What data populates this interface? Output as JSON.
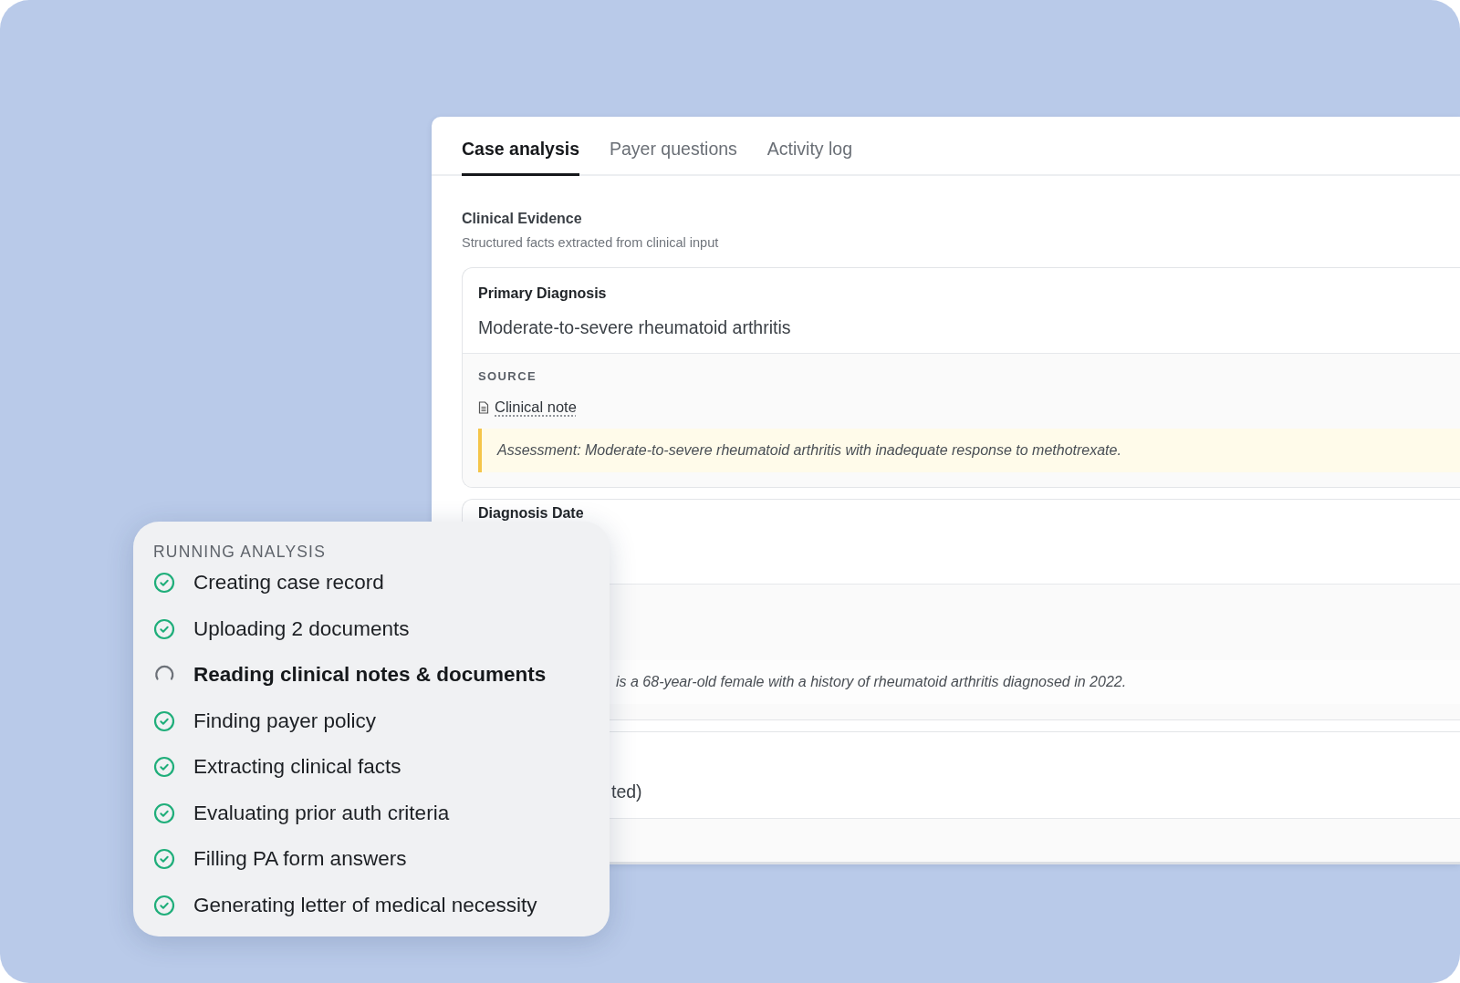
{
  "tabs": [
    {
      "label": "Case analysis",
      "selected": true
    },
    {
      "label": "Payer questions",
      "selected": false
    },
    {
      "label": "Activity log",
      "selected": false
    }
  ],
  "section": {
    "title": "Clinical Evidence",
    "subtitle": "Structured facts extracted from clinical input"
  },
  "evidence": [
    {
      "label": "Primary Diagnosis",
      "value": "Moderate-to-severe rheumatoid arthritis",
      "source_heading": "SOURCE",
      "source_link": "Clinical note",
      "quote": "Assessment: Moderate-to-severe rheumatoid arthritis with inadequate response to methotrexate.",
      "highlighted": true
    },
    {
      "label": "Diagnosis Date",
      "quote": "is a 68-year-old female with a history of rheumatoid arthritis diagnosed in 2022.",
      "highlighted": false
    },
    {
      "value": "ted)"
    }
  ],
  "analysis": {
    "title": "RUNNING ANALYSIS",
    "steps": [
      {
        "label": "Creating case record",
        "done": true
      },
      {
        "label": "Uploading 2 documents",
        "done": true
      },
      {
        "label": "Reading clinical notes & documents",
        "done": false
      },
      {
        "label": "Finding payer policy",
        "done": true
      },
      {
        "label": "Extracting clinical facts",
        "done": true
      },
      {
        "label": "Evaluating prior auth criteria",
        "done": true
      },
      {
        "label": "Filling PA form answers",
        "done": true
      },
      {
        "label": "Generating letter of medical necessity",
        "done": true
      }
    ]
  }
}
